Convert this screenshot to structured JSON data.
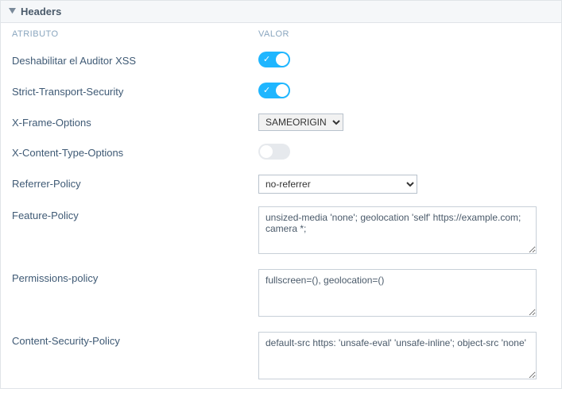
{
  "panel": {
    "title": "Headers"
  },
  "columns": {
    "attribute": "ATRIBUTO",
    "value": "VALOR"
  },
  "rows": {
    "xss": {
      "label": "Deshabilitar el Auditor XSS",
      "enabled": true
    },
    "hsts": {
      "label": "Strict-Transport-Security",
      "enabled": true
    },
    "xframe": {
      "label": "X-Frame-Options",
      "selected": "SAMEORIGIN",
      "options": [
        "SAMEORIGIN"
      ]
    },
    "xcontent": {
      "label": "X-Content-Type-Options",
      "enabled": false
    },
    "referrer": {
      "label": "Referrer-Policy",
      "selected": "no-referrer",
      "options": [
        "no-referrer"
      ]
    },
    "feature": {
      "label": "Feature-Policy",
      "value": "unsized-media 'none'; geolocation 'self' https://example.com; camera *;"
    },
    "permissions": {
      "label": "Permissions-policy",
      "value": "fullscreen=(), geolocation=()"
    },
    "csp": {
      "label": "Content-Security-Policy",
      "value": "default-src https: 'unsafe-eval' 'unsafe-inline'; object-src 'none'"
    }
  }
}
